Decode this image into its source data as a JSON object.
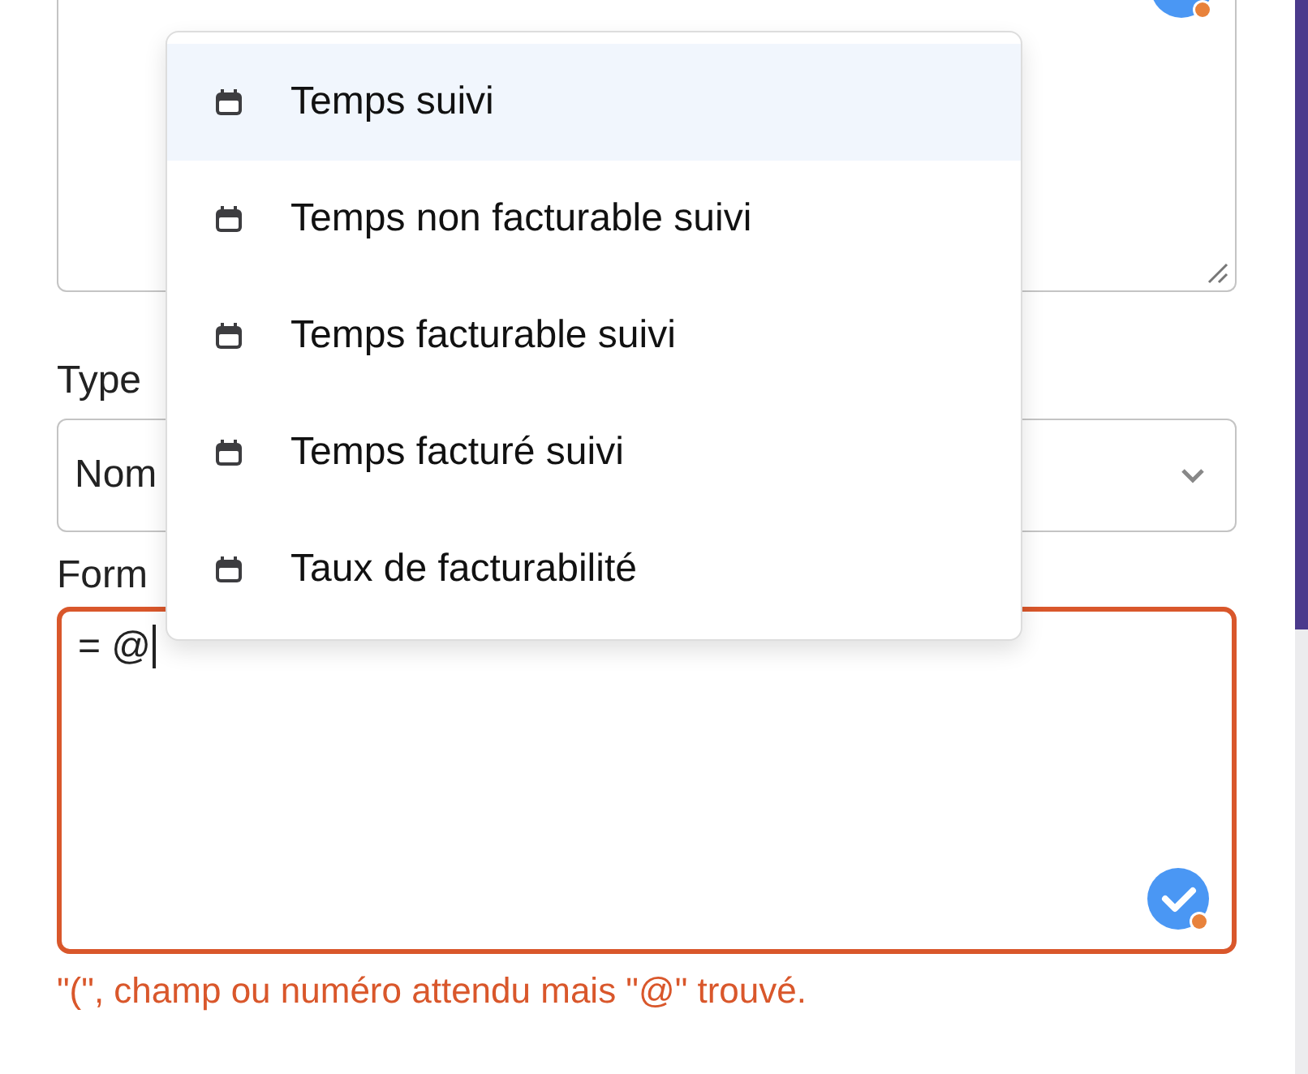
{
  "suggestions": {
    "items": [
      {
        "label": "Temps suivi",
        "selected": true
      },
      {
        "label": "Temps non facturable suivi",
        "selected": false
      },
      {
        "label": "Temps facturable suivi",
        "selected": false
      },
      {
        "label": "Temps facturé suivi",
        "selected": false
      },
      {
        "label": "Taux de facturabilité",
        "selected": false
      }
    ]
  },
  "type_field": {
    "label": "Type",
    "value": "Nom"
  },
  "formula_field": {
    "label": "Form",
    "value": "= @",
    "invalid": true,
    "error": "\"(\", champ ou numéro attendu mais \"@\" trouvé."
  }
}
